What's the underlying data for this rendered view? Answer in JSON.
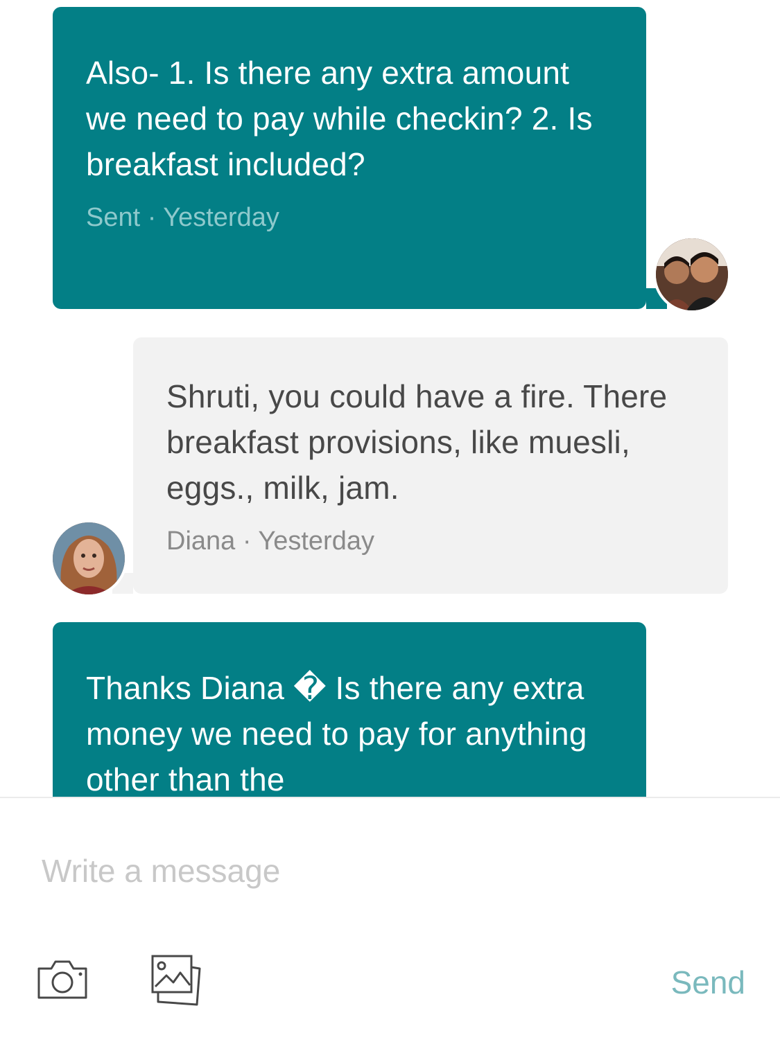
{
  "messages": [
    {
      "direction": "outgoing",
      "text": "Also- 1. Is there any extra amount we need to pay while checkin? 2. Is breakfast included?",
      "meta": "Sent · Yesterday"
    },
    {
      "direction": "incoming",
      "text": "Shruti, you could have a fire. There breakfast provisions, like muesli, eggs., milk, jam.",
      "meta": "Diana · Yesterday"
    },
    {
      "direction": "outgoing",
      "text": "Thanks Diana � Is there any extra money we need to pay for anything other than the"
    }
  ],
  "composer": {
    "placeholder": "Write a message",
    "send_label": "Send",
    "camera_icon": "camera-icon",
    "gallery_icon": "image-gallery-icon"
  },
  "colors": {
    "outgoing_bubble": "#037f86",
    "incoming_bubble": "#f2f2f2",
    "send_text": "#7ab9bd",
    "placeholder": "#c8c8c8"
  }
}
